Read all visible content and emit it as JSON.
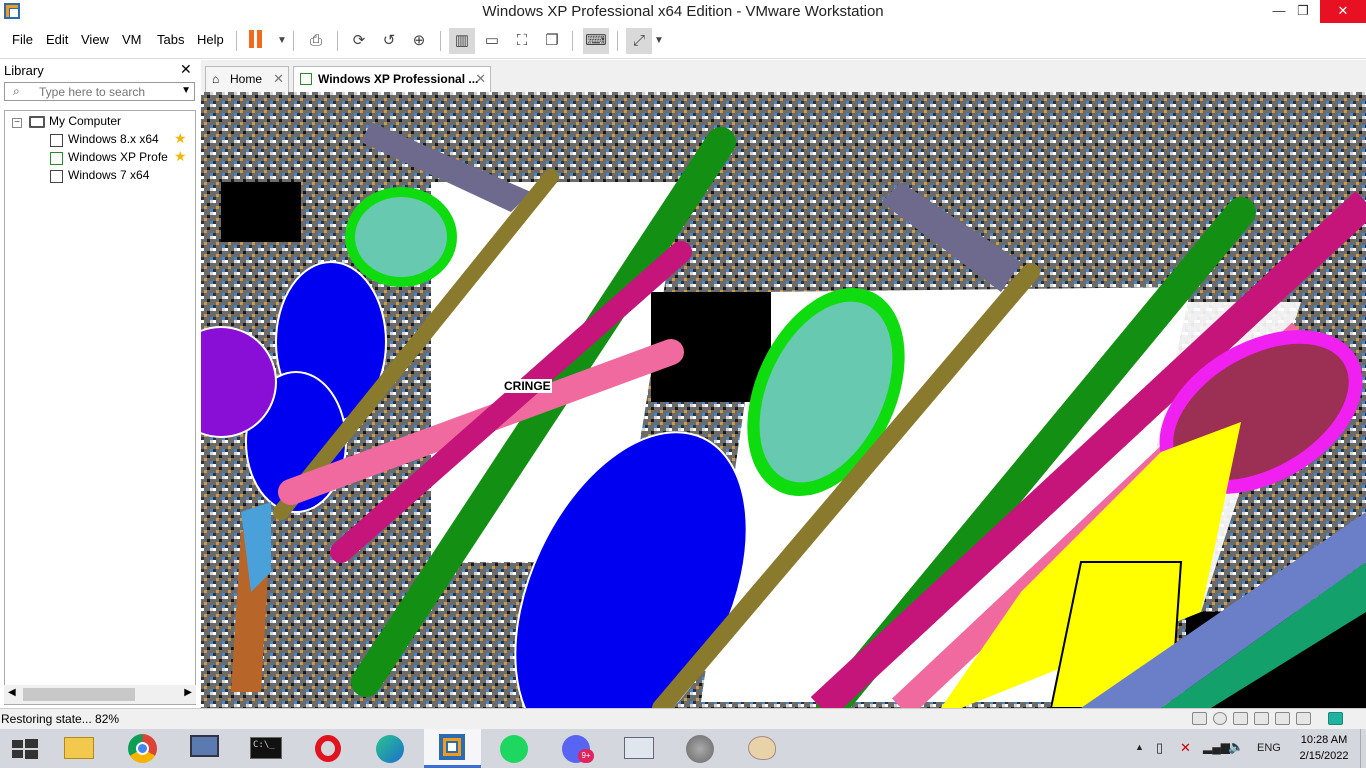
{
  "window": {
    "title": "Windows XP Professional x64 Edition - VMware Workstation",
    "minimize": "—",
    "maximize": "❐",
    "close": "✕"
  },
  "menu": {
    "items": [
      "File",
      "Edit",
      "View",
      "VM",
      "Tabs",
      "Help"
    ]
  },
  "library": {
    "title": "Library",
    "close": "✕",
    "search_placeholder": "Type here to search",
    "tree": {
      "root": "My Computer",
      "items": [
        {
          "label": "Windows 8.x x64",
          "favorite": true
        },
        {
          "label": "Windows XP Profes",
          "favorite": true
        },
        {
          "label": "Windows 7 x64",
          "favorite": false
        }
      ]
    }
  },
  "tabs": [
    {
      "label": "Home",
      "close": "✕"
    },
    {
      "label": "Windows XP Professional ...",
      "close": "✕"
    }
  ],
  "vm": {
    "overlay_text": "CRINGE"
  },
  "status": {
    "text": "Restoring state... 82%",
    "progress_percent": 82
  },
  "taskbar": {
    "apps": [
      "file-explorer",
      "chrome",
      "remote-desktop",
      "command-prompt",
      "opera",
      "edge",
      "vmware-workstation",
      "spotify",
      "discord",
      "performance-monitor",
      "speaker",
      "paint"
    ],
    "discord_badge": "9+",
    "language": "ENG",
    "time": "10:28 AM",
    "date": "2/15/2022"
  },
  "colors": {
    "accent_orange": "#f26b1d",
    "close_red": "#e81123",
    "taskbar_bg": "#d4d7dd"
  }
}
